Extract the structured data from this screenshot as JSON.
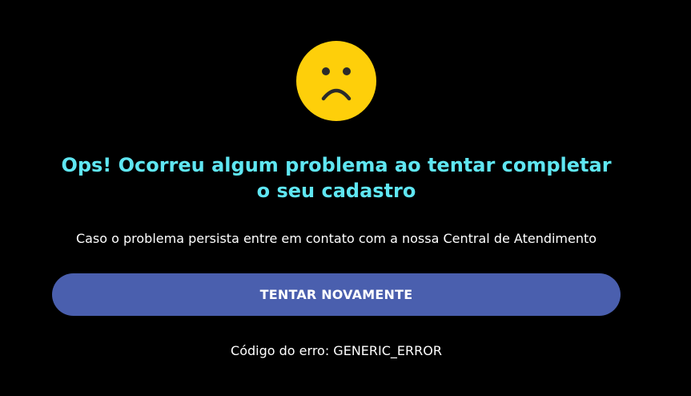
{
  "error_page": {
    "icon": "sad-face-icon",
    "title": "Ops! Ocorreu algum problema ao tentar completar o seu cadastro",
    "message": "Caso o problema persista entre em contato com a nossa Central de Atendimento",
    "retry_button_label": "TENTAR NOVAMENTE",
    "error_code_label": "Código do erro: GENERIC_ERROR"
  },
  "colors": {
    "background": "#000000",
    "title": "#5fe6f2",
    "button": "#4a5fae",
    "face": "#fecf0a",
    "face_features": "#2a2a2a",
    "text": "#ffffff"
  }
}
